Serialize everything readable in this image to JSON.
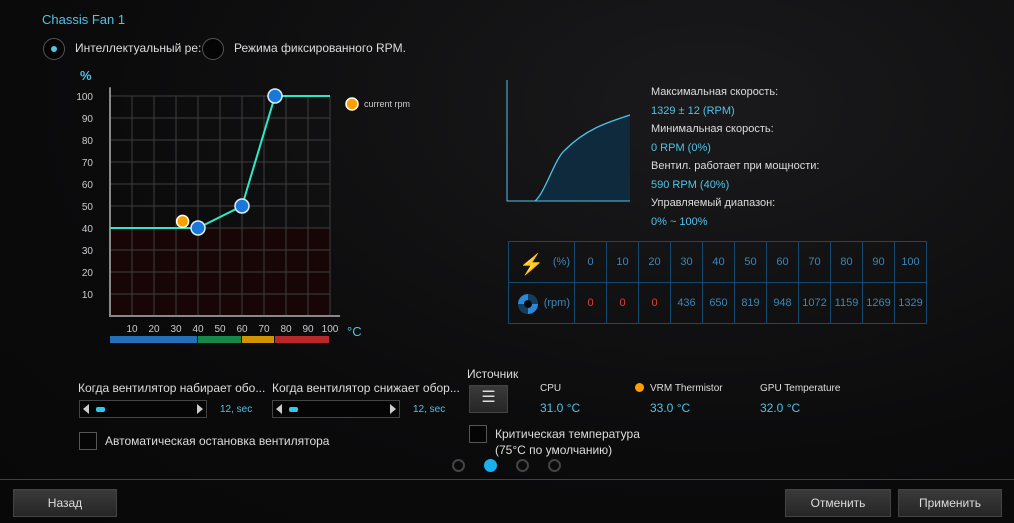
{
  "title": "Chassis Fan 1",
  "modes": [
    {
      "label": "Интеллектуальный ре:",
      "selected": true
    },
    {
      "label": "Режима фиксированного RPM.",
      "selected": false
    }
  ],
  "chart_data": {
    "type": "line",
    "ylabel": "%",
    "xlabel": "°C",
    "yticks": [
      "100",
      "90",
      "80",
      "70",
      "60",
      "50",
      "40",
      "30",
      "20",
      "10"
    ],
    "xticks": [
      "10",
      "20",
      "30",
      "40",
      "50",
      "60",
      "70",
      "80",
      "90",
      "100"
    ],
    "xlim": [
      0,
      100
    ],
    "ylim": [
      0,
      100
    ],
    "grid": true,
    "points": [
      [
        0,
        40
      ],
      [
        40,
        40
      ],
      [
        60,
        50
      ],
      [
        75,
        100
      ],
      [
        100,
        100
      ]
    ],
    "control_points": [
      [
        40,
        40
      ],
      [
        60,
        50
      ],
      [
        75,
        100
      ]
    ],
    "current": {
      "name": "current rpm",
      "x": 33,
      "y": 43
    },
    "zones": [
      {
        "from": 0,
        "to": 40,
        "color": "#2370b8"
      },
      {
        "from": 40,
        "to": 60,
        "color": "#168848"
      },
      {
        "from": 60,
        "to": 75,
        "color": "#d09400"
      },
      {
        "from": 75,
        "to": 100,
        "color": "#b82828"
      }
    ],
    "colors": {
      "line": "#2ee8c8",
      "point": "#1a78d8",
      "current": "#ffa000",
      "low_fill": "#180505"
    }
  },
  "info": {
    "max_label": "Максимальная скорость:",
    "max_value": "1329 ± 12 (RPM)",
    "min_label": "Минимальная скорость:",
    "min_value": "0 RPM (0%)",
    "start_label": "Вентил. работает при мощности:",
    "start_value": "590 RPM (40%)",
    "range_label": "Управляемый диапазон:",
    "range_value": "0% ~ 100%"
  },
  "table": {
    "pct_label": "(%)",
    "rpm_label": "(rpm)",
    "pct": [
      "0",
      "10",
      "20",
      "30",
      "40",
      "50",
      "60",
      "70",
      "80",
      "90",
      "100"
    ],
    "rpm": [
      "0",
      "0",
      "0",
      "436",
      "650",
      "819",
      "948",
      "1072",
      "1159",
      "1269",
      "1329"
    ]
  },
  "spinup": {
    "label": "Когда вентилятор набирает обо...",
    "value": "12, sec",
    "level": 0.08
  },
  "spindown": {
    "label": "Когда вентилятор снижает обор...",
    "value": "12, sec",
    "level": 0.08
  },
  "auto_stop": {
    "label": "Автоматическая остановка вентилятора",
    "checked": false
  },
  "source": {
    "label": "Источник"
  },
  "sensors": [
    {
      "name": "CPU",
      "value": "31.0 °C",
      "active": false
    },
    {
      "name": "VRM Thermistor",
      "value": "33.0 °C",
      "active": true
    },
    {
      "name": "GPU Temperature",
      "value": "32.0 °C",
      "active": false
    }
  ],
  "critical": {
    "line1": "Критическая температура",
    "line2": "(75°C по умолчанию)",
    "checked": false
  },
  "pager": {
    "count": 4,
    "current": 2
  },
  "buttons": {
    "back": "Назад",
    "cancel": "Отменить",
    "apply": "Применить"
  }
}
